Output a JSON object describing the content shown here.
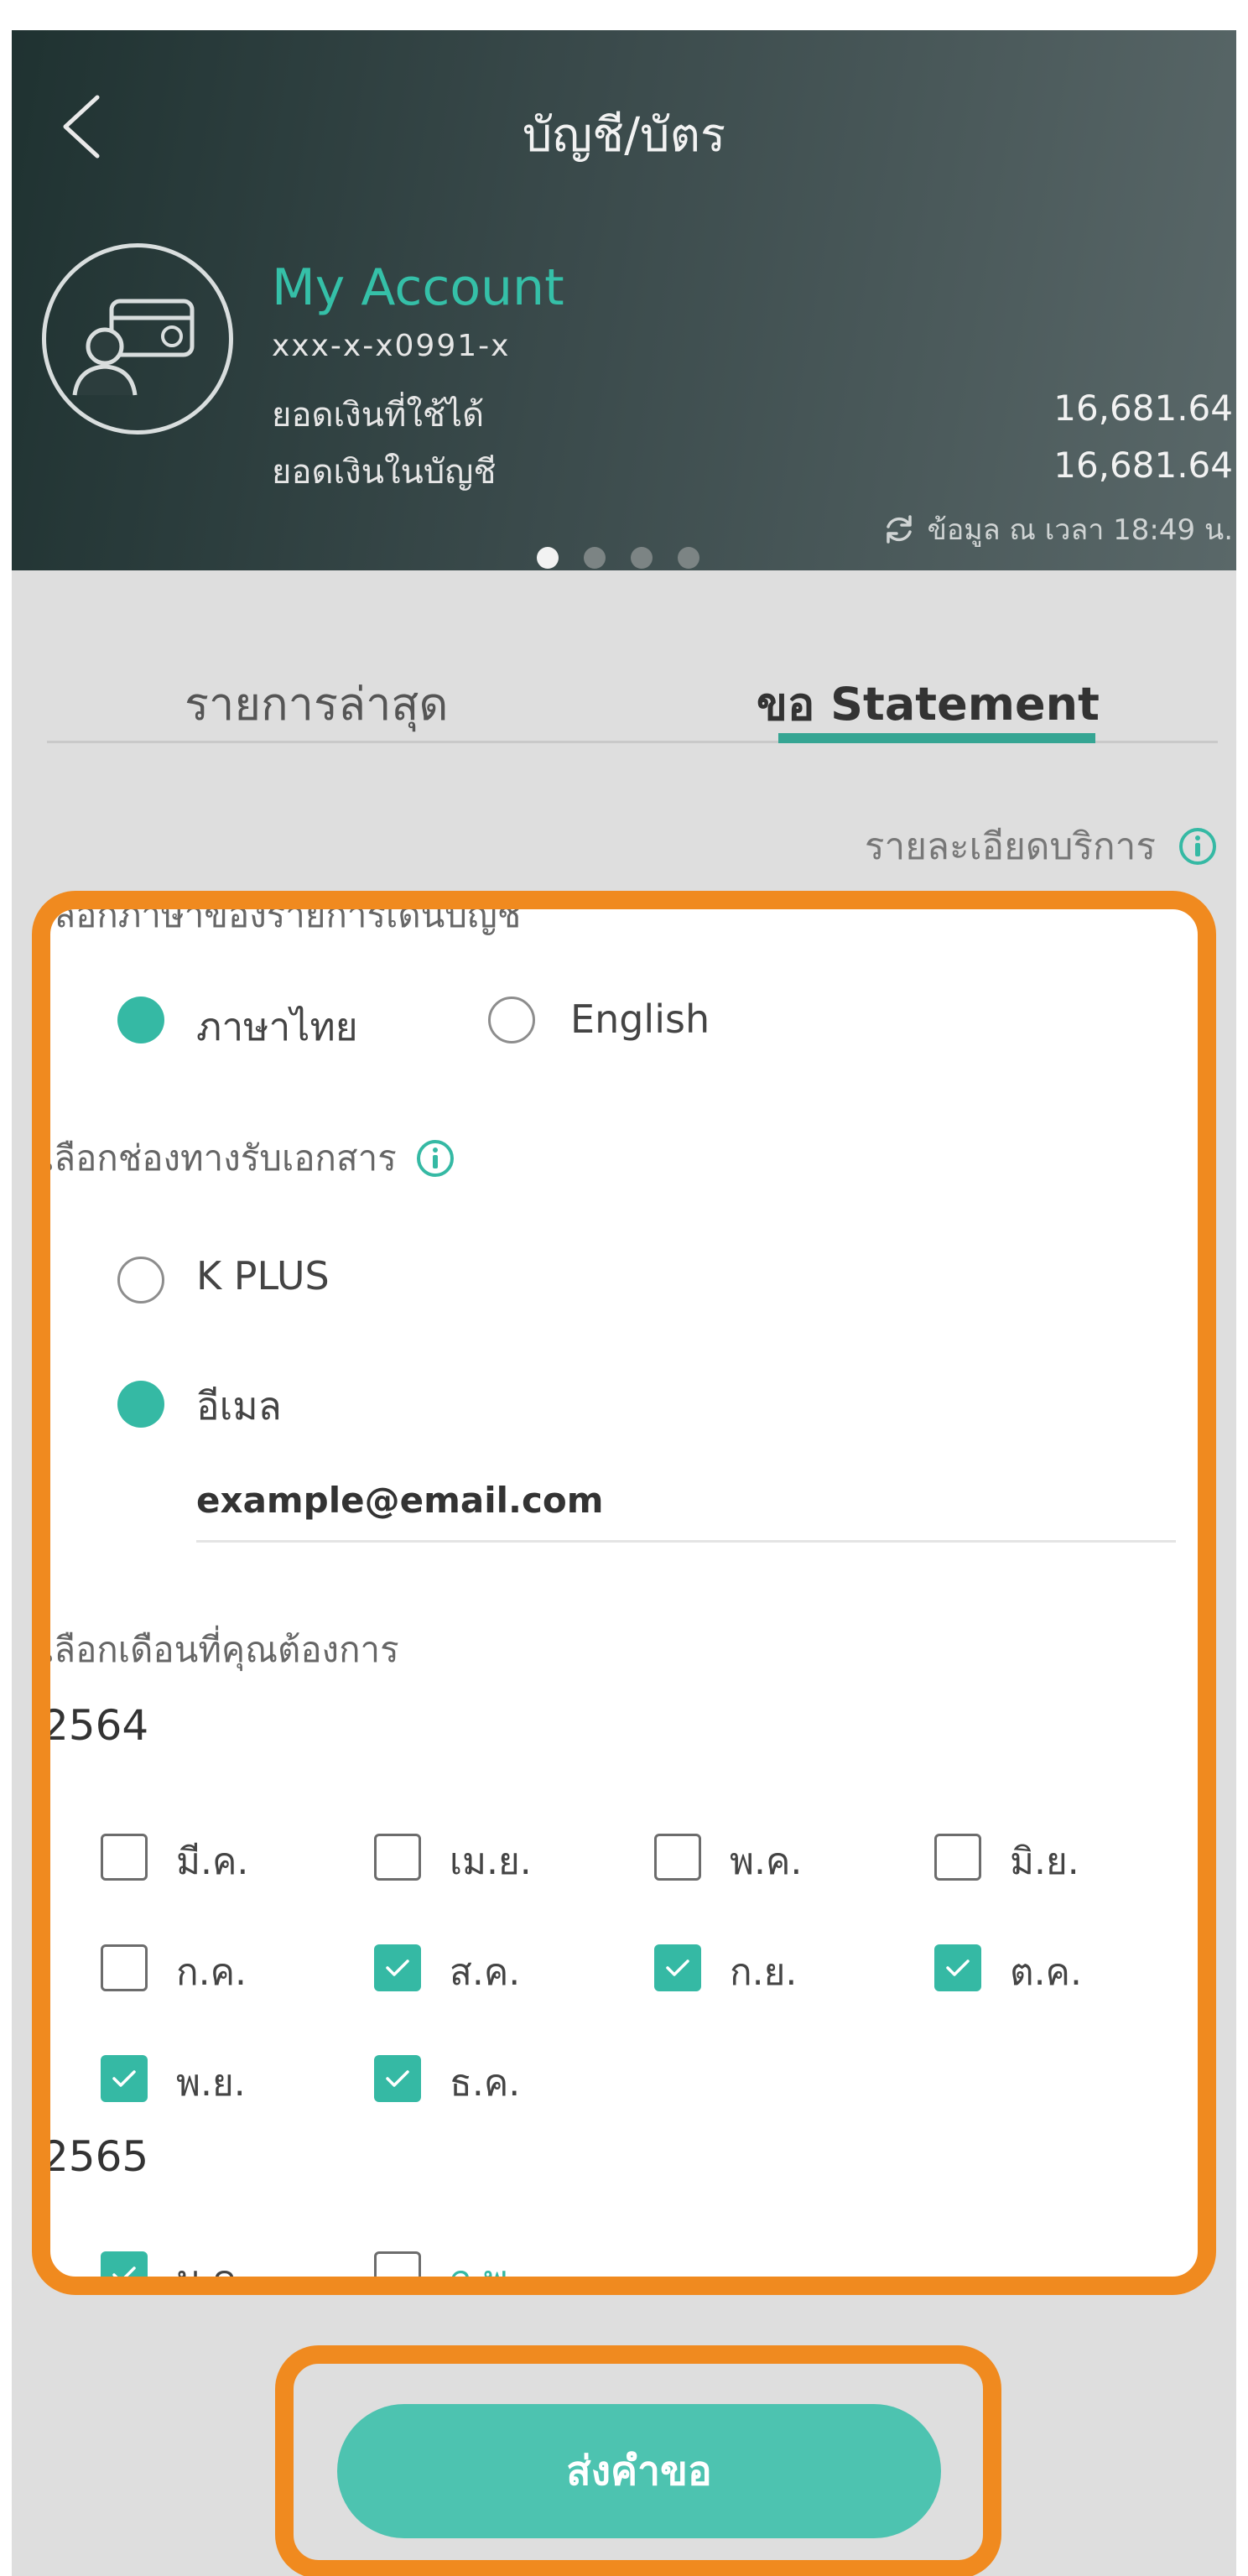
{
  "header": {
    "title": "บัญชี/บัตร",
    "account_name": "My Account",
    "account_number": "xxx-x-x0991-x",
    "available_label": "ยอดเงินที่ใช้ได้",
    "available_value": "16,681.64",
    "balance_label": "ยอดเงินในบัญชี",
    "balance_value": "16,681.64",
    "updated_text": "ข้อมูล ณ เวลา 18:49 น.",
    "page_dots": 4,
    "active_dot": 1
  },
  "tabs": [
    {
      "label": "รายการล่าสุด",
      "active": false
    },
    {
      "label": "ขอ Statement",
      "active": true
    }
  ],
  "service_info_label": "รายละเอียดบริการ",
  "language": {
    "label": "เลือกภาษาของรายการเดินบัญชี",
    "options": [
      {
        "label": "ภาษาไทย",
        "selected": true
      },
      {
        "label": "English",
        "selected": false
      }
    ]
  },
  "channel": {
    "label": "เลือกช่องทางรับเอกสาร",
    "options": [
      {
        "label": "K PLUS",
        "selected": false
      },
      {
        "label": "อีเมล",
        "selected": true
      }
    ],
    "email_value": "example@email.com"
  },
  "months": {
    "label": "เลือกเดือนที่คุณต้องการ",
    "years": [
      {
        "year": "2564",
        "items": [
          {
            "label": "มี.ค.",
            "checked": false
          },
          {
            "label": "เม.ย.",
            "checked": false
          },
          {
            "label": "พ.ค.",
            "checked": false
          },
          {
            "label": "มิ.ย.",
            "checked": false
          },
          {
            "label": "ก.ค.",
            "checked": false
          },
          {
            "label": "ส.ค.",
            "checked": true
          },
          {
            "label": "ก.ย.",
            "checked": true
          },
          {
            "label": "ต.ค.",
            "checked": true
          },
          {
            "label": "พ.ย.",
            "checked": true
          },
          {
            "label": "ธ.ค.",
            "checked": true
          }
        ]
      },
      {
        "year": "2565",
        "items": [
          {
            "label": "ม.ค.",
            "checked": true
          },
          {
            "label": "ก.พ.",
            "checked": false
          }
        ]
      }
    ]
  },
  "submit_label": "ส่งคำขอ",
  "colors": {
    "accent": "#35b9a4",
    "highlight": "#f08a1f",
    "header_dark": "#1f3231"
  }
}
